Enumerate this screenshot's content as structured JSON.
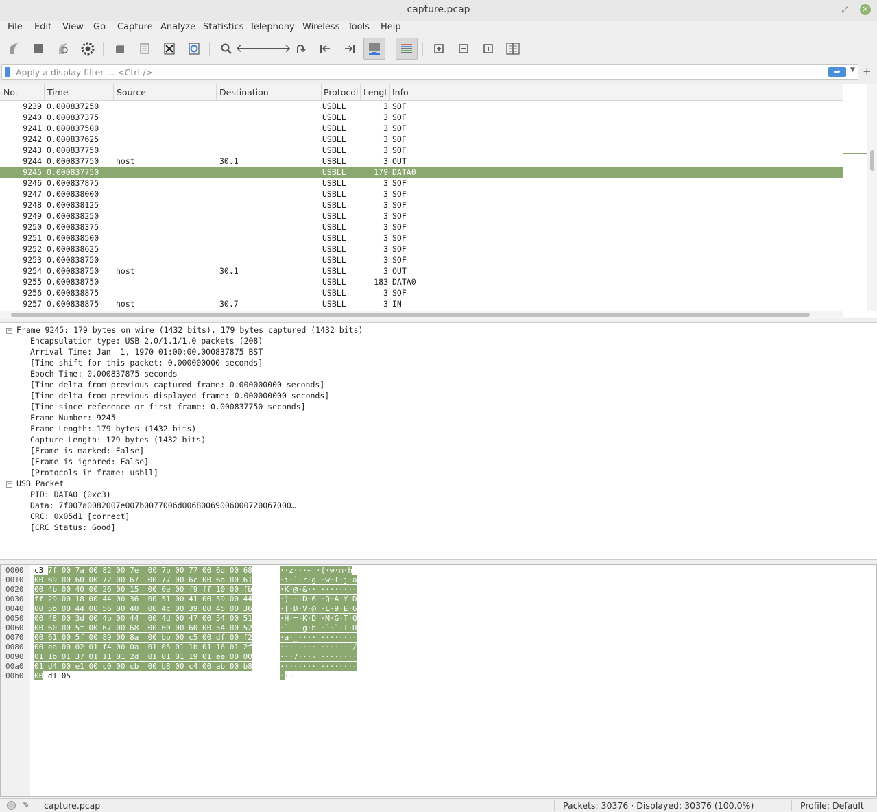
{
  "window": {
    "title": "capture.pcap"
  },
  "menu": [
    "File",
    "Edit",
    "View",
    "Go",
    "Capture",
    "Analyze",
    "Statistics",
    "Telephony",
    "Wireless",
    "Tools",
    "Help"
  ],
  "filter": {
    "placeholder": "Apply a display filter ... <Ctrl-/>",
    "value": ""
  },
  "columns": [
    "No.",
    "Time",
    "Source",
    "Destination",
    "Protocol",
    "Lengtl",
    "Info"
  ],
  "packets": [
    {
      "no": "9239",
      "time": "0.000837250",
      "src": "",
      "dst": "",
      "proto": "USBLL",
      "len": "3",
      "info": "SOF"
    },
    {
      "no": "9240",
      "time": "0.000837375",
      "src": "",
      "dst": "",
      "proto": "USBLL",
      "len": "3",
      "info": "SOF"
    },
    {
      "no": "9241",
      "time": "0.000837500",
      "src": "",
      "dst": "",
      "proto": "USBLL",
      "len": "3",
      "info": "SOF"
    },
    {
      "no": "9242",
      "time": "0.000837625",
      "src": "",
      "dst": "",
      "proto": "USBLL",
      "len": "3",
      "info": "SOF"
    },
    {
      "no": "9243",
      "time": "0.000837750",
      "src": "",
      "dst": "",
      "proto": "USBLL",
      "len": "3",
      "info": "SOF"
    },
    {
      "no": "9244",
      "time": "0.000837750",
      "src": "host",
      "dst": "30.1",
      "proto": "USBLL",
      "len": "3",
      "info": "OUT"
    },
    {
      "no": "9245",
      "time": "0.000837750",
      "src": "",
      "dst": "",
      "proto": "USBLL",
      "len": "179",
      "info": "DATA0",
      "selected": true
    },
    {
      "no": "9246",
      "time": "0.000837875",
      "src": "",
      "dst": "",
      "proto": "USBLL",
      "len": "3",
      "info": "SOF"
    },
    {
      "no": "9247",
      "time": "0.000838000",
      "src": "",
      "dst": "",
      "proto": "USBLL",
      "len": "3",
      "info": "SOF"
    },
    {
      "no": "9248",
      "time": "0.000838125",
      "src": "",
      "dst": "",
      "proto": "USBLL",
      "len": "3",
      "info": "SOF"
    },
    {
      "no": "9249",
      "time": "0.000838250",
      "src": "",
      "dst": "",
      "proto": "USBLL",
      "len": "3",
      "info": "SOF"
    },
    {
      "no": "9250",
      "time": "0.000838375",
      "src": "",
      "dst": "",
      "proto": "USBLL",
      "len": "3",
      "info": "SOF"
    },
    {
      "no": "9251",
      "time": "0.000838500",
      "src": "",
      "dst": "",
      "proto": "USBLL",
      "len": "3",
      "info": "SOF"
    },
    {
      "no": "9252",
      "time": "0.000838625",
      "src": "",
      "dst": "",
      "proto": "USBLL",
      "len": "3",
      "info": "SOF"
    },
    {
      "no": "9253",
      "time": "0.000838750",
      "src": "",
      "dst": "",
      "proto": "USBLL",
      "len": "3",
      "info": "SOF"
    },
    {
      "no": "9254",
      "time": "0.000838750",
      "src": "host",
      "dst": "30.1",
      "proto": "USBLL",
      "len": "3",
      "info": "OUT"
    },
    {
      "no": "9255",
      "time": "0.000838750",
      "src": "",
      "dst": "",
      "proto": "USBLL",
      "len": "183",
      "info": "DATA0"
    },
    {
      "no": "9256",
      "time": "0.000838875",
      "src": "",
      "dst": "",
      "proto": "USBLL",
      "len": "3",
      "info": "SOF"
    },
    {
      "no": "9257",
      "time": "0.000838875",
      "src": "host",
      "dst": "30.7",
      "proto": "USBLL",
      "len": "3",
      "info": "IN"
    }
  ],
  "details": {
    "frame": {
      "header": "Frame 9245: 179 bytes on wire (1432 bits), 179 bytes captured (1432 bits)",
      "fields": [
        "Encapsulation type: USB 2.0/1.1/1.0 packets (208)",
        "Arrival Time: Jan  1, 1970 01:00:00.000837875 BST",
        "[Time shift for this packet: 0.000000000 seconds]",
        "Epoch Time: 0.000837875 seconds",
        "[Time delta from previous captured frame: 0.000000000 seconds]",
        "[Time delta from previous displayed frame: 0.000000000 seconds]",
        "[Time since reference or first frame: 0.000837750 seconds]",
        "Frame Number: 9245",
        "Frame Length: 179 bytes (1432 bits)",
        "Capture Length: 179 bytes (1432 bits)",
        "[Frame is marked: False]",
        "[Frame is ignored: False]",
        "[Protocols in frame: usbll]"
      ]
    },
    "usb": {
      "header": "USB Packet",
      "fields": [
        "PID: DATA0 (0xc3)",
        "Data: 7f007a0082007e007b0077006d00680069006000720067000…",
        "CRC: 0x05d1 [correct]",
        "[CRC Status: Good]"
      ]
    }
  },
  "hexdump": [
    {
      "off": "0000",
      "hex_pre": "c3 ",
      "hex_hl": "7f 00 7a 00 82 00 7e  00 7b 00 77 00 6d 00 68",
      "hex_post": "",
      "ascii_hl": "··z···~ ·{·w·m·h",
      "ascii_post": ""
    },
    {
      "off": "0010",
      "hex_pre": "",
      "hex_hl": "00 69 00 60 00 72 00 67  00 77 00 6c 00 6a 00 61",
      "hex_post": "",
      "ascii_hl": "·i·`·r·g ·w·l·j·a",
      "ascii_post": ""
    },
    {
      "off": "0020",
      "hex_pre": "",
      "hex_hl": "00 4b 00 40 00 26 00 15  00 0e 00 f9 ff 10 00 fb",
      "hex_post": "",
      "ascii_hl": "·K·@·&·· ········",
      "ascii_post": ""
    },
    {
      "off": "0030",
      "hex_pre": "",
      "hex_hl": "ff 29 00 18 00 44 00 36  00 51 00 41 00 59 00 44",
      "hex_post": "",
      "ascii_hl": "·)···D·6 ·Q·A·Y·D",
      "ascii_post": ""
    },
    {
      "off": "0040",
      "hex_pre": "",
      "hex_hl": "00 5b 00 44 00 56 00 40  00 4c 00 39 00 45 00 36",
      "hex_post": "",
      "ascii_hl": "·[·D·V·@ ·L·9·E·6",
      "ascii_post": ""
    },
    {
      "off": "0050",
      "hex_pre": "",
      "hex_hl": "00 48 00 3d 00 4b 00 44  00 4d 00 47 00 54 00 51",
      "hex_post": "",
      "ascii_hl": "·H·=·K·D ·M·G·T·Q",
      "ascii_post": ""
    },
    {
      "off": "0060",
      "hex_pre": "",
      "hex_hl": "00 60 00 5f 00 67 00 68  00 60 00 60 00 54 00 52",
      "hex_post": "",
      "ascii_hl": "·`·_·g·h ·`·`·T·R",
      "ascii_post": ""
    },
    {
      "off": "0070",
      "hex_pre": "",
      "hex_hl": "00 61 00 5f 00 89 00 8a  00 bb 00 c5 00 df 00 f2",
      "hex_post": "",
      "ascii_hl": "·a·_···· ········",
      "ascii_post": ""
    },
    {
      "off": "0080",
      "hex_pre": "",
      "hex_hl": "00 ea 00 02 01 f4 00 0a  01 05 01 1b 01 16 01 2f",
      "hex_post": "",
      "ascii_hl": "········ ·······/",
      "ascii_post": ""
    },
    {
      "off": "0090",
      "hex_pre": "",
      "hex_hl": "01 1b 01 37 01 11 01 2d  01 01 01 19 01 ee 00 00",
      "hex_post": "",
      "ascii_hl": "···7···- ········",
      "ascii_post": ""
    },
    {
      "off": "00a0",
      "hex_pre": "",
      "hex_hl": "01 d4 00 e1 00 c0 00 cb  00 b8 00 c4 00 ab 00 b8",
      "hex_post": "",
      "ascii_hl": "········ ········",
      "ascii_post": ""
    },
    {
      "off": "00b0",
      "hex_pre": "",
      "hex_hl": "00",
      "hex_post": " d1 05",
      "ascii_hl": "·",
      "ascii_post": "··"
    }
  ],
  "status": {
    "file": "capture.pcap",
    "counts": "Packets: 30376 · Displayed: 30376 (100.0%)",
    "profile": "Profile: Default"
  },
  "colors": {
    "selection": "#8aa870",
    "accent": "#4a90d9"
  }
}
